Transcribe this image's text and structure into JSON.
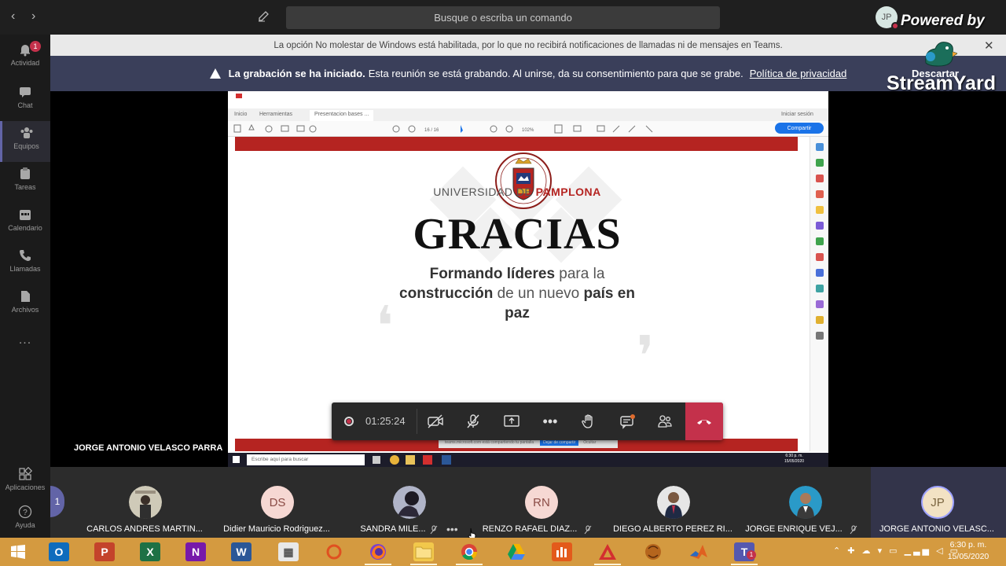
{
  "topbar": {
    "search_placeholder": "Busque o escriba un comando",
    "user_initials": "JP",
    "powered_by": "Powered by",
    "back": "‹",
    "forward": "›"
  },
  "rail": {
    "items": [
      {
        "label": "Actividad",
        "icon": "bell-icon",
        "badge": "1"
      },
      {
        "label": "Chat",
        "icon": "chat-icon"
      },
      {
        "label": "Equipos",
        "icon": "teams-icon"
      },
      {
        "label": "Tareas",
        "icon": "tasks-icon"
      },
      {
        "label": "Calendario",
        "icon": "calendar-icon"
      },
      {
        "label": "Llamadas",
        "icon": "phone-icon"
      },
      {
        "label": "Archivos",
        "icon": "files-icon"
      },
      {
        "label": "Aplicaciones",
        "icon": "apps-icon"
      },
      {
        "label": "Ayuda",
        "icon": "help-icon"
      }
    ],
    "more": "..."
  },
  "banners": {
    "dnd": "La opción No molestar de Windows está habilitada, por lo que no recibirá notificaciones de llamadas ni de mensajes en Teams.",
    "recording_bold": "La grabación se ha iniciado.",
    "recording_text": "Esta reunión se está grabando. Al unirse, da su consentimiento para que se grabe.",
    "privacy_link": "Política de privacidad",
    "dismiss": "Descartar"
  },
  "overlay": {
    "streamyard": "StreamYard"
  },
  "presenter_name": "JORGE ANTONIO VELASCO PARRA",
  "shared_screen": {
    "tab_home": "Inicio",
    "tab_tools": "Herramientas",
    "tab_doc": "Presentacion bases ...",
    "signin": "Iniciar sesión",
    "share_button": "Compartir",
    "page_indicator": "16 / 16",
    "zoom": "102%",
    "taskbar_search": "Escribe aquí para buscar",
    "share_notice": "teams.microsoft.com está compartiendo tu pantalla",
    "stop_sharing": "Dejar de compartir",
    "hide": "Ocultar",
    "clock_time": "6:30 p. m.",
    "clock_date": "15/05/2020"
  },
  "slide": {
    "university_prefix": "UNIVERSIDAD DE ",
    "university_name": "PAMPLONA",
    "title": "GRACIAS",
    "tag_1b": "Formando líderes",
    "tag_2": " para la",
    "tag_3b": "construcción",
    "tag_4": " de un nuevo ",
    "tag_5b": "país en",
    "tag_6b": "paz"
  },
  "controls": {
    "timer": "01:25:24",
    "accent": "#c4314b"
  },
  "participants": [
    {
      "name": "CARLOS ANDRES MARTIN...",
      "initials": "",
      "kind": "photo"
    },
    {
      "name": "Didier Mauricio Rodriguez...",
      "initials": "DS",
      "kind": "initials"
    },
    {
      "name": "SANDRA MILE...",
      "initials": "",
      "kind": "photo"
    },
    {
      "name": "RENZO RAFAEL DIAZ...",
      "initials": "RN",
      "kind": "initials"
    },
    {
      "name": "DIEGO ALBERTO PEREZ RI...",
      "initials": "",
      "kind": "photo"
    },
    {
      "name": "JORGE ENRIQUE VEJ...",
      "initials": "",
      "kind": "photo"
    },
    {
      "name": "JORGE ANTONIO VELASC...",
      "initials": "JP",
      "kind": "initials"
    }
  ],
  "strip_more": "•••",
  "taskbar": {
    "time": "6:30 p. m.",
    "date": "15/05/2020"
  }
}
